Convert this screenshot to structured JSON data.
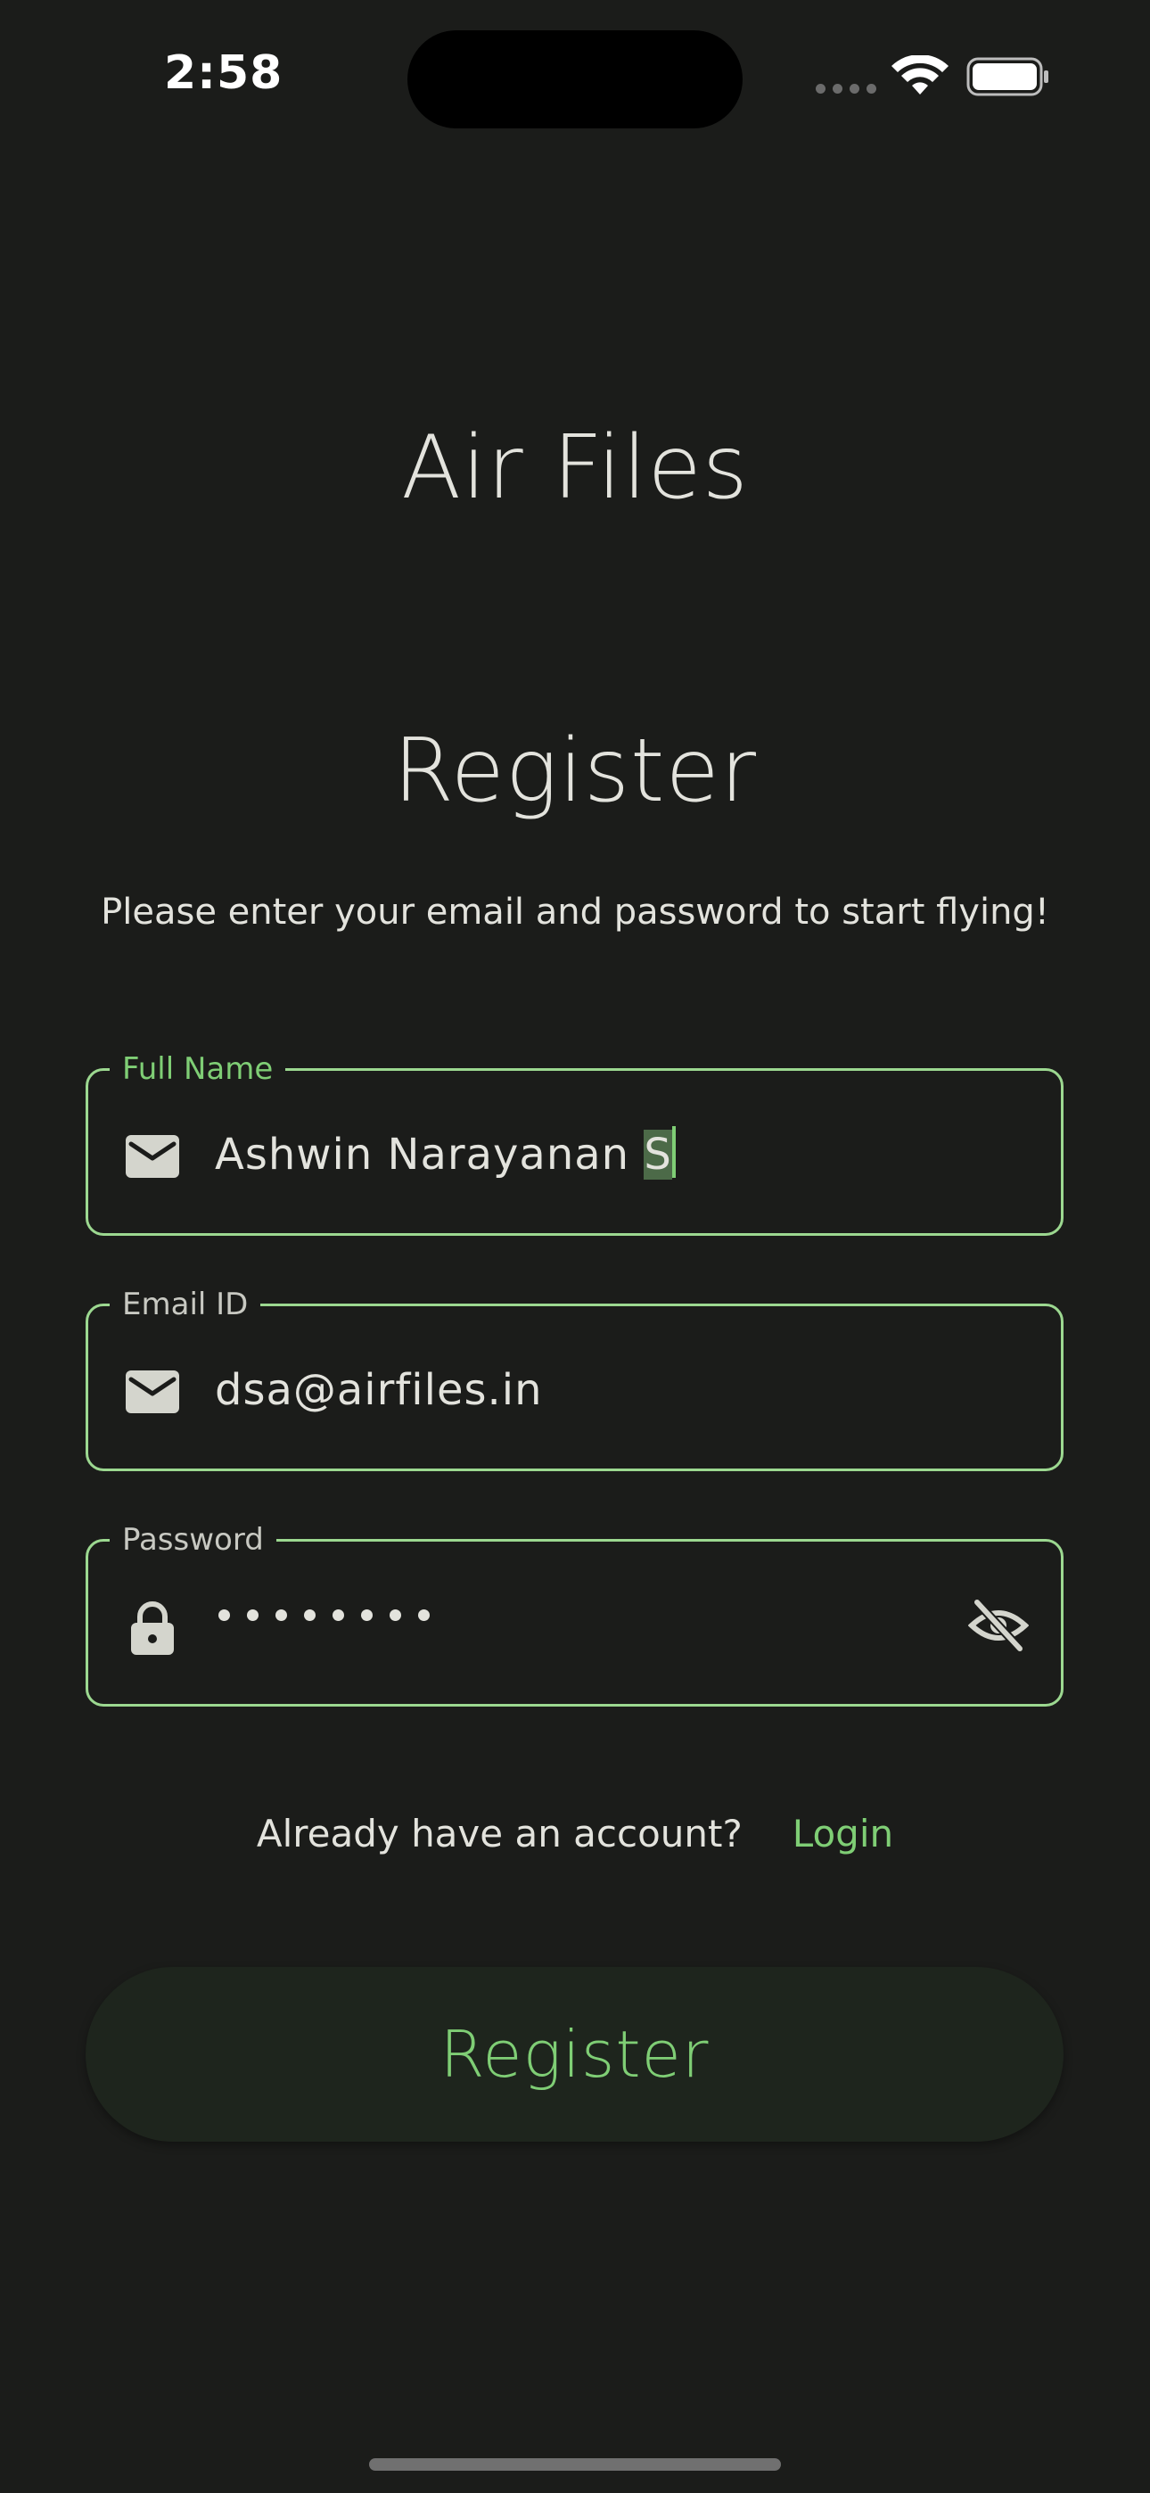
{
  "status_bar": {
    "time": "2:58",
    "icons": [
      "cellular-signal-icon",
      "wifi-icon",
      "battery-icon"
    ]
  },
  "app": {
    "title": "Air Files"
  },
  "page": {
    "title": "Register",
    "subtitle": "Please enter your email and password to start flying!"
  },
  "form": {
    "full_name": {
      "label": "Full Name",
      "value_before_selection": "Ashwin Narayanan ",
      "value_selected": "S",
      "icon": "mail-icon",
      "state": "focused"
    },
    "email": {
      "label": "Email ID",
      "value": "dsa@airfiles.in",
      "icon": "mail-icon"
    },
    "password": {
      "label": "Password",
      "masked_length": 8,
      "icon": "lock-icon",
      "toggle_icon": "eye-off-icon"
    }
  },
  "login_prompt": {
    "text": "Already have an account?",
    "link": "Login"
  },
  "actions": {
    "register_label": "Register"
  },
  "colors": {
    "background": "#1b1c1a",
    "accent": "#7fce75",
    "field_border": "#9cd890",
    "button_bg": "#1e251d",
    "text": "#e3e3dd"
  }
}
